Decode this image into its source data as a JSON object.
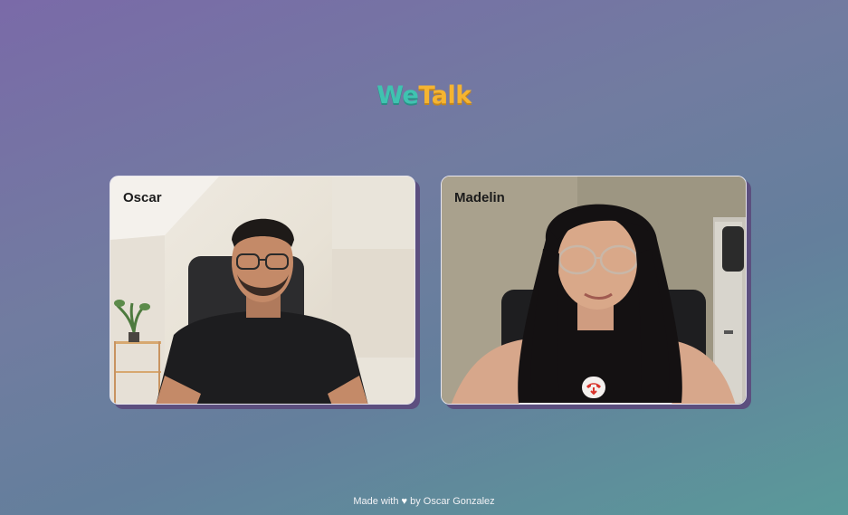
{
  "app": {
    "logo_part1": "We",
    "logo_part2": "Talk"
  },
  "participants": [
    {
      "name": "Oscar"
    },
    {
      "name": "Madelin"
    }
  ],
  "footer": {
    "prefix": "Made with",
    "heart": "♥",
    "suffix": "by Oscar Gonzalez"
  },
  "colors": {
    "logo_we": "#3fc3b0",
    "logo_talk": "#f5b431",
    "tile_shadow": "#5c4f7f",
    "hangup_button": "#d9332b"
  },
  "icons": {
    "hangup": "phone-hangup-icon"
  }
}
